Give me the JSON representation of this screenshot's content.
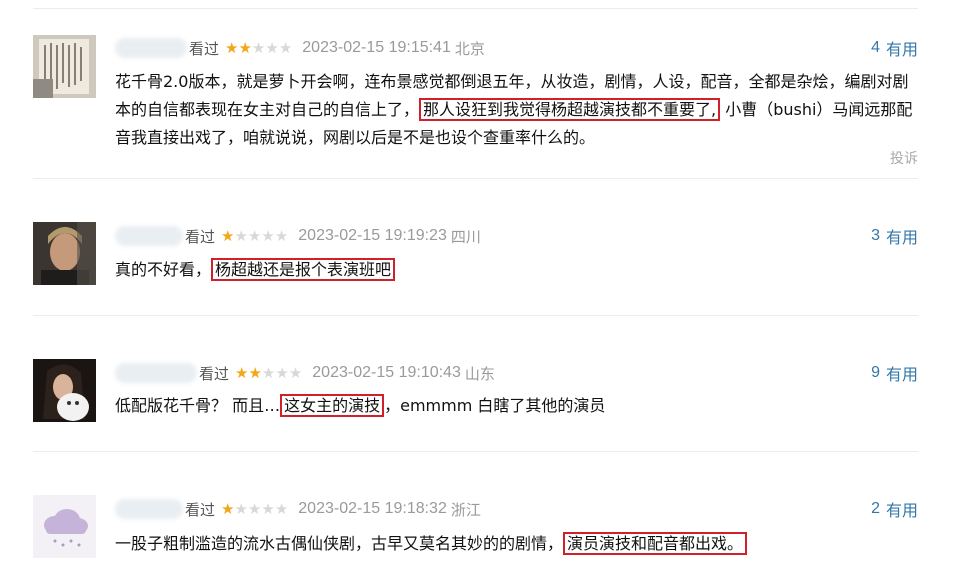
{
  "comments": [
    {
      "status": "看过",
      "rating": 2,
      "time": "2023-02-15 19:15:41",
      "location": "北京",
      "useful_count": "4",
      "useful_label": "有用",
      "text_before": "花千骨2.0版本，就是萝卜开会啊，连布景感觉都倒退五年，从妆造，剧情，人设，配音，全都是杂烩，编剧对剧本的自信都表现在女主对自己的自信上了，",
      "highlight": "那人设狂到我觉得杨超越演技都不重要了,",
      "text_after": " 小曹（bushi）马闻远那配音我直接出戏了，咱就说说，网剧以后是不是也设个查重率什么的。",
      "report": "投诉"
    },
    {
      "status": "看过",
      "rating": 1,
      "time": "2023-02-15 19:19:23",
      "location": "四川",
      "useful_count": "3",
      "useful_label": "有用",
      "text_before": "真的不好看，",
      "highlight": "杨超越还是报个表演班吧",
      "text_after": ""
    },
    {
      "status": "看过",
      "rating": 2,
      "time": "2023-02-15 19:10:43",
      "location": "山东",
      "useful_count": "9",
      "useful_label": "有用",
      "text_before": "低配版花千骨？ 而且…",
      "highlight": "这女主的演技",
      "text_after": "，emmmm 白瞎了其他的演员"
    },
    {
      "status": "看过",
      "rating": 1,
      "time": "2023-02-15 19:18:32",
      "location": "浙江",
      "useful_count": "2",
      "useful_label": "有用",
      "text_before": "一股子粗制滥造的流水古偶仙侠剧，古早又莫名其妙的的剧情，",
      "highlight": "演员演技和配音都出戏。",
      "text_after": ""
    }
  ],
  "colors": {
    "star_on": "#f3a716",
    "useful": "#3377aa",
    "highlight_border": "#d0202a"
  }
}
